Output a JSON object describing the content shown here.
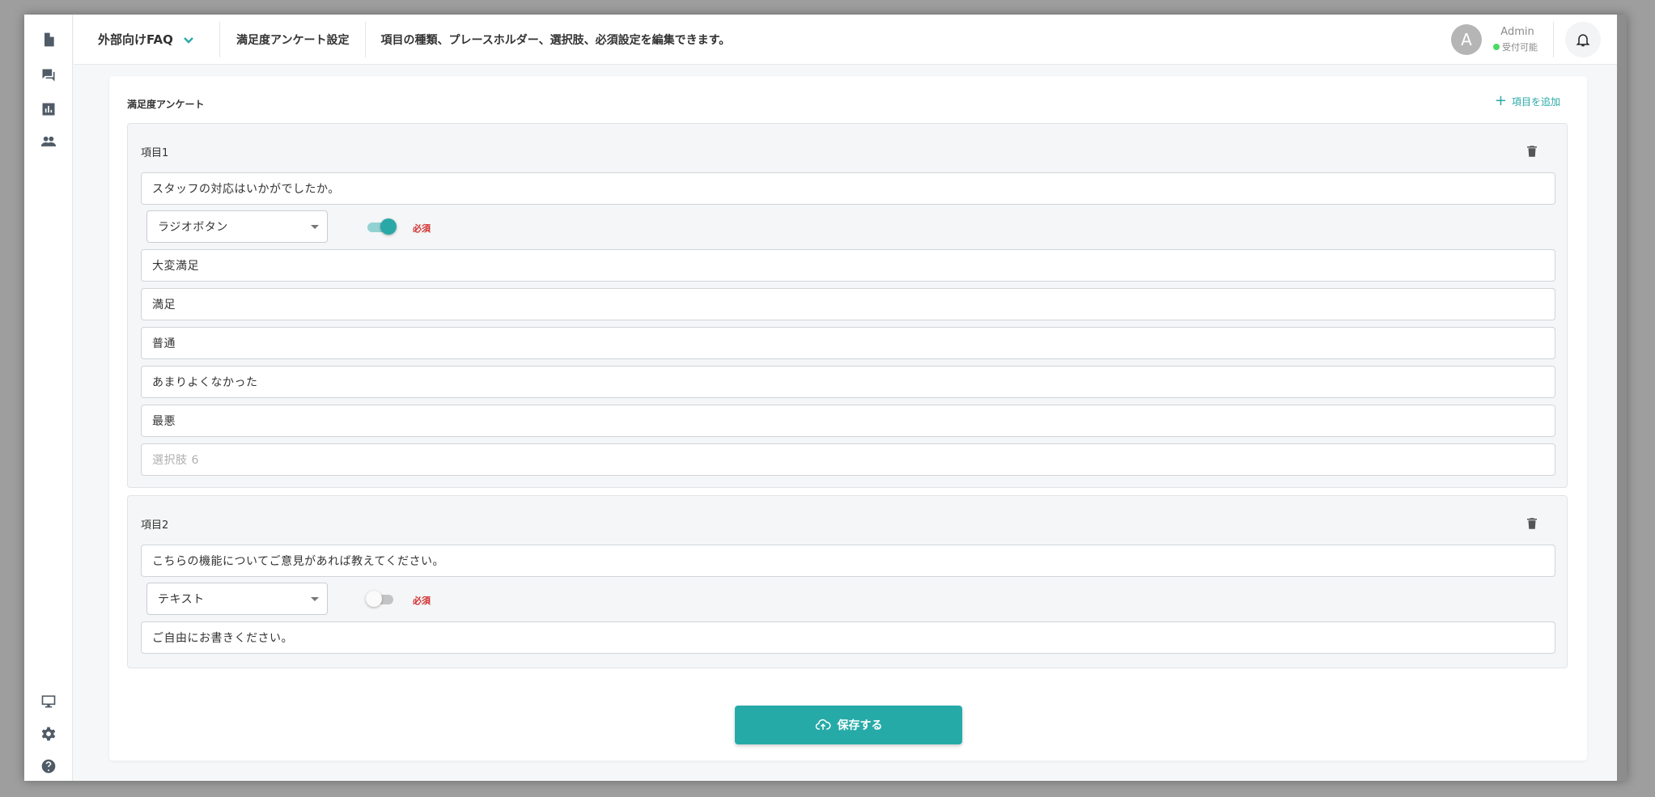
{
  "sidebar": {
    "top_icons": [
      "document-icon",
      "chat-icon",
      "chart-icon",
      "people-icon"
    ],
    "bottom_icons": [
      "monitor-icon",
      "gear-icon",
      "help-icon"
    ]
  },
  "header": {
    "channel": "外部向けFAQ",
    "title": "満足度アンケート設定",
    "description": "項目の種類、プレースホルダー、選択肢、必須設定を編集できます。",
    "user": {
      "avatar_initial": "A",
      "name": "Admin",
      "status": "受付可能"
    }
  },
  "survey": {
    "title": "満足度アンケート",
    "add_item_label": "項目を追加",
    "items": [
      {
        "label": "項目1",
        "question": "スタッフの対応はいかがでしたか。",
        "type": "ラジオボタン",
        "required_on": true,
        "required_label": "必須",
        "options": [
          "大変満足",
          "満足",
          "普通",
          "あまりよくなかった",
          "最悪"
        ],
        "new_option_placeholder": "選択肢 6"
      },
      {
        "label": "項目2",
        "question": "こちらの機能についてご意見があれば教えてください。",
        "type": "テキスト",
        "required_on": false,
        "required_label": "必須",
        "placeholder": "ご自由にお書きください。"
      }
    ]
  },
  "save_label": "保存する",
  "colors": {
    "accent": "#26aaa8",
    "required": "#d32f2f",
    "status_online": "#4cd964"
  }
}
